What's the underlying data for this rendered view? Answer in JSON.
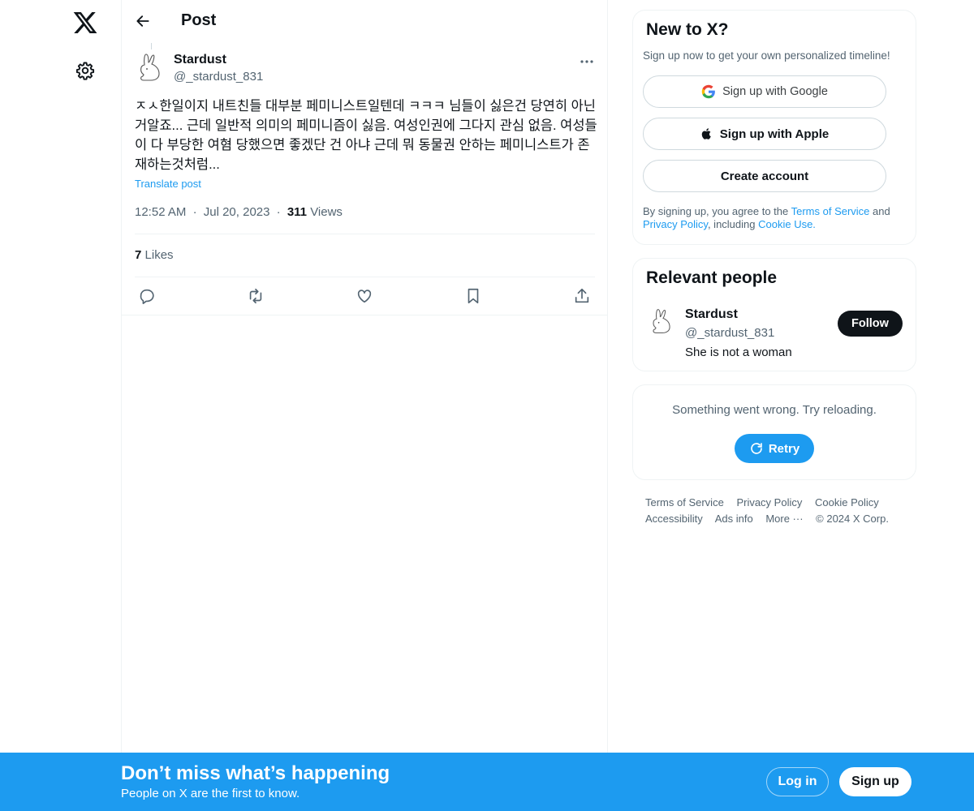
{
  "nav": {
    "logo_icon": "x-logo-icon",
    "settings_icon": "gear-icon"
  },
  "header": {
    "back_icon": "arrow-left-icon",
    "title": "Post"
  },
  "post": {
    "author_name": "Stardust",
    "author_handle": "@_stardust_831",
    "text": "ㅈㅅ한일이지 내트친들 대부분 페미니스트일텐데 ㅋㅋㅋ 님들이 싫은건 당연히 아닌거알죠... 근데 일반적 의미의 페미니즘이 싫음. 여성인권에 그다지 관심 없음. 여성들이 다 부당한 여혐 당했으면 좋겠단 건 아냐 근데 뭐 동물권 안하는 페미니스트가 존재하는것처럼...",
    "translate_label": "Translate post",
    "time": "12:52 AM",
    "date": "Jul 20, 2023",
    "views_count": "311",
    "views_label": "Views",
    "likes_count": "7",
    "likes_label": "Likes",
    "separator": "·"
  },
  "sidebar": {
    "signup_card": {
      "title": "New to X?",
      "subtitle": "Sign up now to get your own personalized timeline!",
      "google_label": "Sign up with Google",
      "apple_label": "Sign up with Apple",
      "create_label": "Create account",
      "terms_prefix": "By signing up, you agree to the ",
      "terms_link": "Terms of Service",
      "terms_and": " and ",
      "privacy_link": "Privacy Policy",
      "terms_including": ", including ",
      "cookie_link": "Cookie Use."
    },
    "relevant": {
      "title": "Relevant people",
      "name": "Stardust",
      "handle": "@_stardust_831",
      "bio": "She is not a woman",
      "follow_label": "Follow"
    },
    "error": {
      "message": "Something went wrong. Try reloading.",
      "retry_label": "Retry"
    },
    "footer": {
      "links": [
        "Terms of Service",
        "Privacy Policy",
        "Cookie Policy",
        "Accessibility",
        "Ads info",
        "More ···",
        "© 2024 X Corp."
      ]
    }
  },
  "banner": {
    "title": "Don’t miss what’s happening",
    "subtitle": "People on X are the first to know.",
    "login_label": "Log in",
    "signup_label": "Sign up"
  },
  "colors": {
    "accent": "#1d9bf0",
    "text_primary": "#0f1419",
    "text_secondary": "#536471",
    "border": "#eff3f4"
  }
}
